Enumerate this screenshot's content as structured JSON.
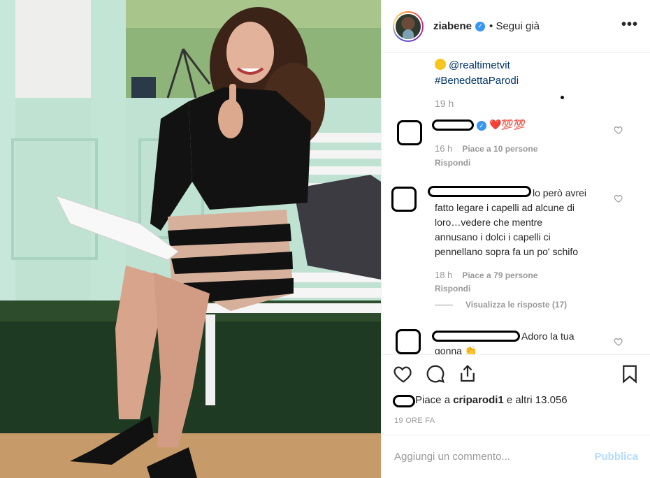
{
  "post": {
    "username": "ziabene",
    "follow_status": "• Segui già",
    "more_icon": "ellipsis-icon"
  },
  "caption": {
    "line1": "@realtimetvit",
    "line2": "#BenedettaParodi",
    "time": "19 h"
  },
  "comments": [
    {
      "text": "❤️💯💯",
      "time": "16 h",
      "likes": "Piace a 10 persone",
      "reply": "Rispondi"
    },
    {
      "text_lines": [
        "lo però avrei",
        "fatto legare i capelli ad alcune di",
        "loro…vedere che mentre",
        "annusano i dolci i capelli ci",
        "pennellano sopra fa un po' schifo"
      ],
      "time": "18 h",
      "likes": "Piace a 79 persone",
      "reply": "Rispondi",
      "view_replies": "Visualizza le risposte (17)"
    },
    {
      "text_lines": [
        "Adoro la tua",
        "gonna 👏"
      ]
    }
  ],
  "actions": {
    "liked_by": "Piace a",
    "liked_by_user": "criparodi1",
    "liked_others": "e altri 13.056",
    "time_ago": "19 ORE FA"
  },
  "add_comment": {
    "placeholder": "Aggiungi un commento...",
    "publish": "Pubblica"
  },
  "colors": {
    "link": "#003569",
    "muted": "#999999",
    "publish_disabled": "#b3dbff",
    "verified": "#3897f0"
  }
}
